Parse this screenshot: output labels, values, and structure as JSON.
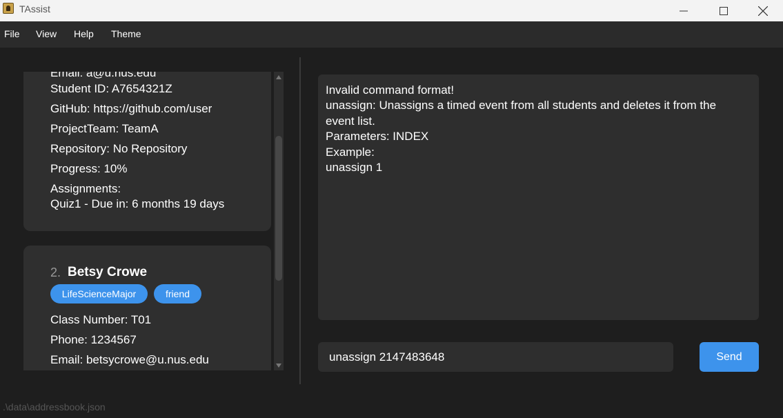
{
  "window": {
    "title": "TAssist"
  },
  "menu": {
    "items": [
      "File",
      "View",
      "Help",
      "Theme"
    ]
  },
  "person_list": {
    "card1": {
      "partial_top_line": "Email: a@u.nus.edu",
      "lines": [
        "Student ID: A7654321Z",
        "GitHub: https://github.com/user",
        "ProjectTeam: TeamA",
        "Repository: No Repository",
        "Progress: 10%",
        "Assignments:",
        "Quiz1 - Due in: 6 months 19 days"
      ]
    },
    "card2": {
      "index": "2.",
      "name": "Betsy Crowe",
      "tags": [
        "LifeScienceMajor",
        "friend"
      ],
      "lines": [
        "Class Number: T01",
        "Phone: 1234567",
        "Email: betsycrowe@u.nus.edu"
      ]
    }
  },
  "result_display": {
    "lines": [
      "Invalid command format!",
      "unassign: Unassigns a timed event from all students and deletes it from the",
      "event list.",
      "Parameters: INDEX",
      "Example:",
      "unassign 1"
    ]
  },
  "command_box": {
    "value": "unassign 2147483648"
  },
  "send_button": {
    "label": "Send"
  },
  "status_bar": {
    "path": ".\\data\\addressbook.json"
  },
  "colors": {
    "accent": "#3d93ec",
    "background": "#1e1e1e",
    "card": "#2f2f2f",
    "titlebar": "#f3f3f3"
  }
}
